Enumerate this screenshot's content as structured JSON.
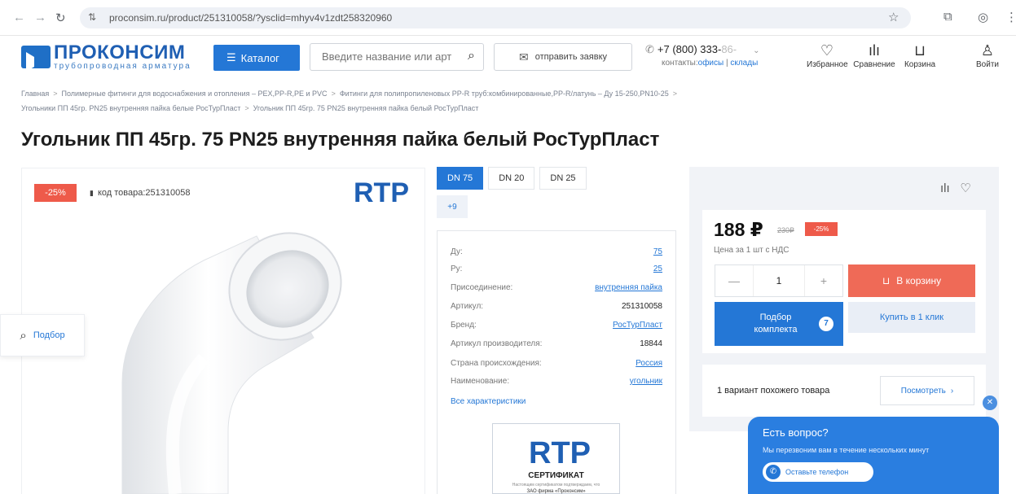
{
  "browser": {
    "url": "proconsim.ru/product/251310058/?ysclid=mhyv4v1zdt258320960"
  },
  "header": {
    "logo_name": "ПРОКОНСИМ",
    "logo_tag": "трубопроводная арматура",
    "catalog_label": "Каталог",
    "search_placeholder": "Введите название или арт",
    "send_request_label": "отправить заявку",
    "phone_main": "+7 (800) 333-",
    "phone_faded": "86-",
    "contacts_label": "контакты:",
    "offices_label": "офисы",
    "warehouses_label": "склады",
    "icons": [
      {
        "name": "favorites",
        "label": "Избранное",
        "glyph": "♡"
      },
      {
        "name": "compare",
        "label": "Сравнение",
        "glyph": "ılı"
      },
      {
        "name": "cart",
        "label": "Корзина",
        "glyph": "⊔"
      },
      {
        "name": "login",
        "label": "Войти",
        "glyph": "♙"
      }
    ]
  },
  "breadcrumbs": {
    "items": [
      "Главная",
      "Полимерные фитинги для водоснабжения и отопления – PEX,PP-R,PE и PVC",
      "Фитинги для полипропиленовых PP-R труб:комбинированные,PP-R/латунь – Ду 15-250,PN10-25",
      "Угольники ПП 45гр. PN25 внутренняя пайка белые РосТурПласт",
      "Угольник ПП 45гр. 75 PN25 внутренняя пайка белый РосТурПласт"
    ]
  },
  "product": {
    "title": "Угольник ПП 45гр. 75 PN25 внутренняя пайка белый РосТурПласт",
    "discount_badge": "-25%",
    "code_label": "код товара:",
    "code_value": "251310058",
    "brand_logo": "RTP",
    "side_podbor": "Подбор"
  },
  "variants": {
    "tabs": [
      "DN 75",
      "DN 20",
      "DN 25"
    ],
    "more": "+9"
  },
  "specs": {
    "rows": [
      {
        "label": "Ду:",
        "value": "75",
        "link": true
      },
      {
        "label": "Ру:",
        "value": "25",
        "link": true
      },
      {
        "label": "Присоединение:",
        "value": "внутренняя пайка",
        "link": true
      },
      {
        "label": "Артикул:",
        "value": "251310058",
        "link": false
      },
      {
        "label": "Бренд:",
        "value": "РосТурПласт",
        "link": true
      },
      {
        "label": "Артикул производителя:",
        "value": "18844",
        "link": false
      },
      {
        "label": "Страна происхождения:",
        "value": "Россия",
        "link": true
      },
      {
        "label": "Наименование:",
        "value": "угольник",
        "link": true
      }
    ],
    "all_link": "Все характеристики",
    "cert_logo": "RTP",
    "cert_title": "СЕРТИФИКАТ",
    "cert_small": "Настоящим сертификатом подтверждаем, что",
    "cert_company": "ЗАО фирма «Проконсим»"
  },
  "buy": {
    "price": "188 ₽",
    "old_price": "230₽",
    "discount": "-25%",
    "unit": "Цена за 1 шт с НДС",
    "qty_minus": "—",
    "qty_value": "1",
    "qty_plus": "+",
    "to_cart": "В корзину",
    "kit_label": "Подбор комплекта",
    "kit_count": "7",
    "one_click": "Купить в 1 клик",
    "similar_text": "1 вариант похожего товара",
    "similar_btn": "Посмотреть"
  },
  "chat": {
    "question": "Есть вопрос?",
    "subtitle": "Мы перезвоним вам в течение нескольких минут",
    "button": "Оставьте телефон"
  },
  "colors": {
    "brand_blue": "#2477d6",
    "accent_red": "#ee5a4a",
    "cart_red": "#ef6a57"
  }
}
